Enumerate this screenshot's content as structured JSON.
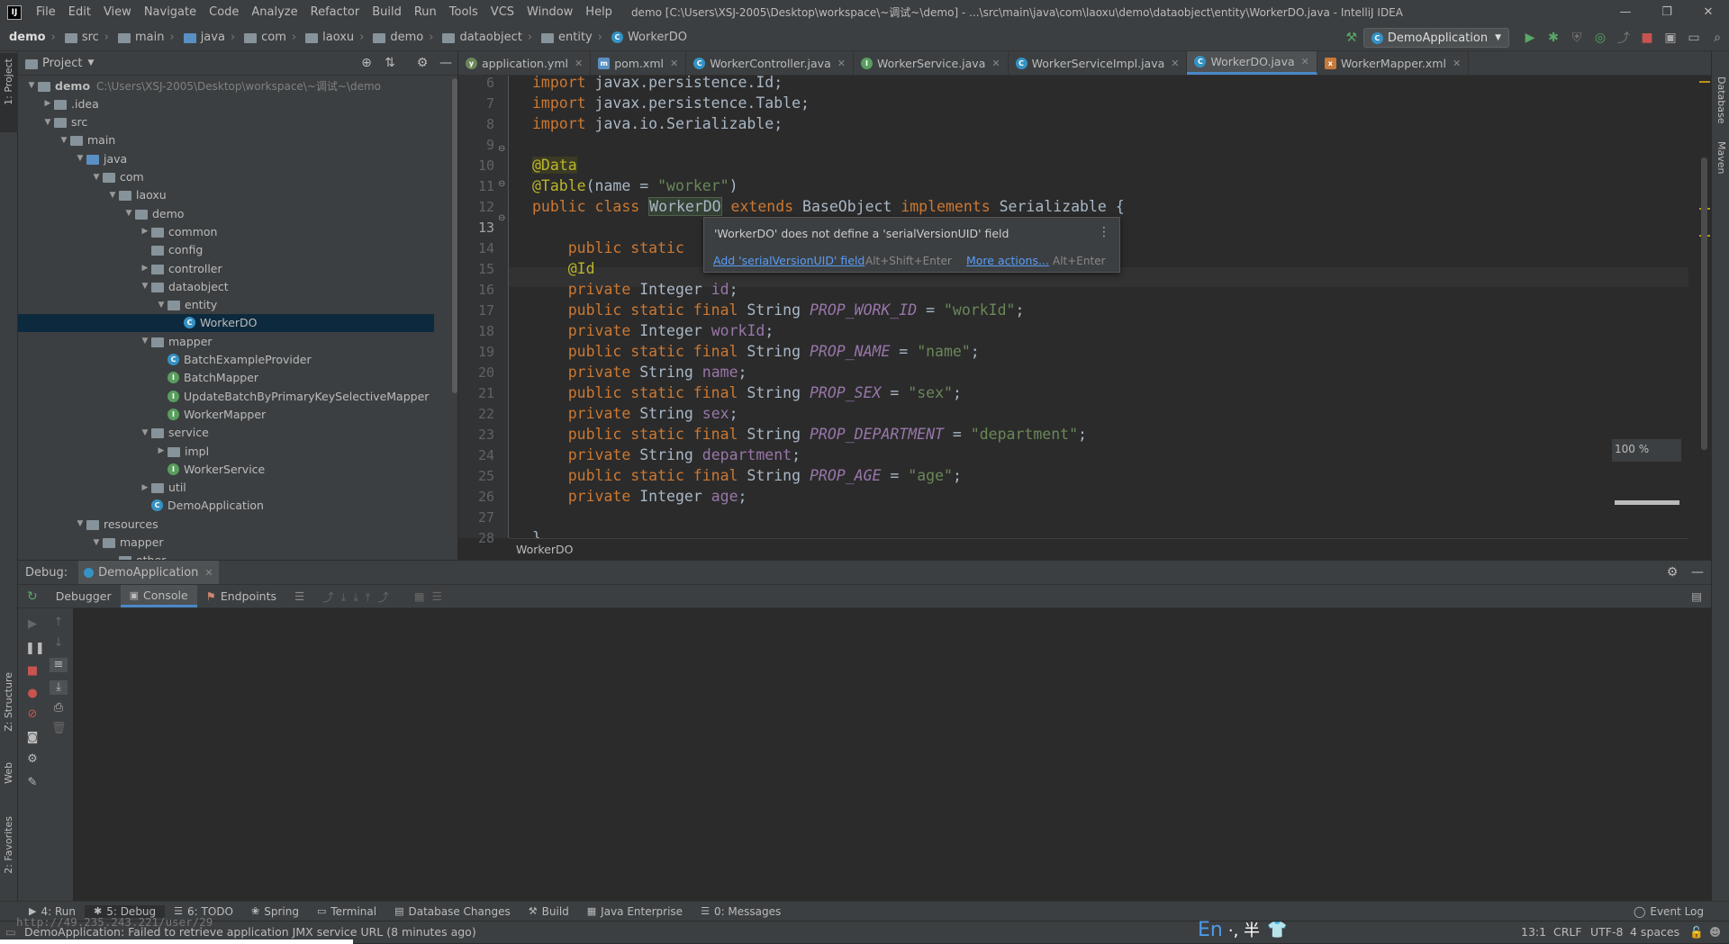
{
  "app": {
    "logo": "IJ",
    "menus": [
      "File",
      "Edit",
      "View",
      "Navigate",
      "Code",
      "Analyze",
      "Refactor",
      "Build",
      "Run",
      "Tools",
      "VCS",
      "Window",
      "Help"
    ],
    "title": "demo [C:\\Users\\XSJ-2005\\Desktop\\workspace\\~调试~\\demo] - ...\\src\\main\\java\\com\\laoxu\\demo\\dataobject\\entity\\WorkerDO.java - IntelliJ IDEA"
  },
  "breadcrumbs": [
    "demo",
    "src",
    "main",
    "java",
    "com",
    "laoxu",
    "demo",
    "dataobject",
    "entity",
    "WorkerDO"
  ],
  "run_config": "DemoApplication",
  "left_tools": {
    "project": "1: Project",
    "structure": "Z: Structure",
    "web": "Web",
    "favorites": "2: Favorites"
  },
  "right_tools": {
    "database": "Database",
    "maven": "Maven"
  },
  "project_panel": {
    "title": "Project",
    "tree": [
      {
        "label": "demo",
        "note": "C:\\Users\\XSJ-2005\\Desktop\\workspace\\~调试~\\demo",
        "depth": 0,
        "arrow": "open",
        "icon": "folder"
      },
      {
        "label": ".idea",
        "depth": 1,
        "arrow": "closed",
        "icon": "folder"
      },
      {
        "label": "src",
        "depth": 1,
        "arrow": "open",
        "icon": "folder"
      },
      {
        "label": "main",
        "depth": 2,
        "arrow": "open",
        "icon": "folder"
      },
      {
        "label": "java",
        "depth": 3,
        "arrow": "open",
        "icon": "folder-blue"
      },
      {
        "label": "com",
        "depth": 4,
        "arrow": "open",
        "icon": "folder"
      },
      {
        "label": "laoxu",
        "depth": 5,
        "arrow": "open",
        "icon": "folder"
      },
      {
        "label": "demo",
        "depth": 6,
        "arrow": "open",
        "icon": "folder"
      },
      {
        "label": "common",
        "depth": 7,
        "arrow": "closed",
        "icon": "folder"
      },
      {
        "label": "config",
        "depth": 7,
        "arrow": "none",
        "icon": "folder"
      },
      {
        "label": "controller",
        "depth": 7,
        "arrow": "closed",
        "icon": "folder"
      },
      {
        "label": "dataobject",
        "depth": 7,
        "arrow": "open",
        "icon": "folder"
      },
      {
        "label": "entity",
        "depth": 8,
        "arrow": "open",
        "icon": "folder"
      },
      {
        "label": "WorkerDO",
        "depth": 9,
        "arrow": "none",
        "icon": "class",
        "selected": true
      },
      {
        "label": "mapper",
        "depth": 7,
        "arrow": "open",
        "icon": "folder"
      },
      {
        "label": "BatchExampleProvider",
        "depth": 8,
        "arrow": "none",
        "icon": "class"
      },
      {
        "label": "BatchMapper",
        "depth": 8,
        "arrow": "none",
        "icon": "interface"
      },
      {
        "label": "UpdateBatchByPrimaryKeySelectiveMapper",
        "depth": 8,
        "arrow": "none",
        "icon": "interface"
      },
      {
        "label": "WorkerMapper",
        "depth": 8,
        "arrow": "none",
        "icon": "interface"
      },
      {
        "label": "service",
        "depth": 7,
        "arrow": "open",
        "icon": "folder"
      },
      {
        "label": "impl",
        "depth": 8,
        "arrow": "closed",
        "icon": "folder"
      },
      {
        "label": "WorkerService",
        "depth": 8,
        "arrow": "none",
        "icon": "interface"
      },
      {
        "label": "util",
        "depth": 7,
        "arrow": "closed",
        "icon": "folder"
      },
      {
        "label": "DemoApplication",
        "depth": 7,
        "arrow": "none",
        "icon": "class"
      },
      {
        "label": "resources",
        "depth": 3,
        "arrow": "open",
        "icon": "folder"
      },
      {
        "label": "mapper",
        "depth": 4,
        "arrow": "open",
        "icon": "folder"
      },
      {
        "label": "other",
        "depth": 5,
        "arrow": "none",
        "icon": "folder"
      }
    ]
  },
  "editor_tabs": [
    {
      "label": "application.yml",
      "icon": "yml"
    },
    {
      "label": "pom.xml",
      "icon": "maven"
    },
    {
      "label": "WorkerController.java",
      "icon": "class"
    },
    {
      "label": "WorkerService.java",
      "icon": "interface"
    },
    {
      "label": "WorkerServiceImpl.java",
      "icon": "class"
    },
    {
      "label": "WorkerDO.java",
      "icon": "class",
      "active": true
    },
    {
      "label": "WorkerMapper.xml",
      "icon": "xml"
    }
  ],
  "code": [
    {
      "n": "6",
      "segs": [
        [
          "kw",
          "import "
        ],
        [
          "",
          "javax.persistence."
        ],
        [
          "",
          "Id;"
        ]
      ]
    },
    {
      "n": "7",
      "segs": [
        [
          "kw",
          "import "
        ],
        [
          "",
          "javax.persistence."
        ],
        [
          "",
          "Table;"
        ]
      ]
    },
    {
      "n": "8",
      "segs": [
        [
          "kw",
          "import "
        ],
        [
          "",
          "java.io.Serializable;"
        ]
      ]
    },
    {
      "n": "9",
      "segs": []
    },
    {
      "n": "10",
      "segs": [
        [
          "ann hl-ann",
          "@Data"
        ]
      ]
    },
    {
      "n": "11",
      "segs": [
        [
          "ann",
          "@Table"
        ],
        [
          "",
          "(name = "
        ],
        [
          "str",
          "\"worker\""
        ],
        [
          "",
          ")"
        ]
      ]
    },
    {
      "n": "12",
      "segs": [
        [
          "kw",
          "public class "
        ],
        [
          "hl-word",
          "WorkerDO"
        ],
        [
          "kw",
          " extends "
        ],
        [
          "",
          "BaseObject "
        ],
        [
          "kw",
          "implements "
        ],
        [
          "",
          "Serializable {"
        ]
      ]
    },
    {
      "n": "13",
      "segs": []
    },
    {
      "n": "14",
      "segs": [
        [
          "kw",
          "    public static "
        ]
      ]
    },
    {
      "n": "15",
      "segs": [
        [
          "ann",
          "    @Id"
        ]
      ]
    },
    {
      "n": "16",
      "segs": [
        [
          "kw",
          "    private "
        ],
        [
          "",
          "Integer "
        ],
        [
          "fld",
          "id"
        ],
        [
          "",
          ";"
        ]
      ]
    },
    {
      "n": "17",
      "segs": [
        [
          "kw",
          "    public static final "
        ],
        [
          "",
          "String "
        ],
        [
          "cst",
          "PROP_WORK_ID"
        ],
        [
          "",
          " = "
        ],
        [
          "str",
          "\"workId\""
        ],
        [
          "",
          ";"
        ]
      ]
    },
    {
      "n": "18",
      "segs": [
        [
          "kw",
          "    private "
        ],
        [
          "",
          "Integer "
        ],
        [
          "fld",
          "workId"
        ],
        [
          "",
          ";"
        ]
      ]
    },
    {
      "n": "19",
      "segs": [
        [
          "kw",
          "    public static final "
        ],
        [
          "",
          "String "
        ],
        [
          "cst",
          "PROP_NAME"
        ],
        [
          "",
          " = "
        ],
        [
          "str",
          "\"name\""
        ],
        [
          "",
          ";"
        ]
      ]
    },
    {
      "n": "20",
      "segs": [
        [
          "kw",
          "    private "
        ],
        [
          "",
          "String "
        ],
        [
          "fld",
          "name"
        ],
        [
          "",
          ";"
        ]
      ]
    },
    {
      "n": "21",
      "segs": [
        [
          "kw",
          "    public static final "
        ],
        [
          "",
          "String "
        ],
        [
          "cst",
          "PROP_SEX"
        ],
        [
          "",
          " = "
        ],
        [
          "str",
          "\"sex\""
        ],
        [
          "",
          ";"
        ]
      ]
    },
    {
      "n": "22",
      "segs": [
        [
          "kw",
          "    private "
        ],
        [
          "",
          "String "
        ],
        [
          "fld",
          "sex"
        ],
        [
          "",
          ";"
        ]
      ]
    },
    {
      "n": "23",
      "segs": [
        [
          "kw",
          "    public static final "
        ],
        [
          "",
          "String "
        ],
        [
          "cst",
          "PROP_DEPARTMENT"
        ],
        [
          "",
          " = "
        ],
        [
          "str",
          "\"department\""
        ],
        [
          "",
          ";"
        ]
      ]
    },
    {
      "n": "24",
      "segs": [
        [
          "kw",
          "    private "
        ],
        [
          "",
          "String "
        ],
        [
          "fld",
          "department"
        ],
        [
          "",
          ";"
        ]
      ]
    },
    {
      "n": "25",
      "segs": [
        [
          "kw",
          "    public static final "
        ],
        [
          "",
          "String "
        ],
        [
          "cst",
          "PROP_AGE"
        ],
        [
          "",
          " = "
        ],
        [
          "str",
          "\"age\""
        ],
        [
          "",
          ";"
        ]
      ]
    },
    {
      "n": "26",
      "segs": [
        [
          "kw",
          "    private "
        ],
        [
          "",
          "Integer "
        ],
        [
          "fld",
          "age"
        ],
        [
          "",
          ";"
        ]
      ]
    },
    {
      "n": "27",
      "segs": []
    },
    {
      "n": "28",
      "segs": [
        [
          "",
          "}"
        ]
      ]
    }
  ],
  "editor_breadcrumb": "WorkerDO",
  "tooltip": {
    "message": "'WorkerDO' does not define a 'serialVersionUID' field",
    "action1": "Add 'serialVersionUID' field",
    "key1": "Alt+Shift+Enter",
    "action2": "More actions...",
    "key2": "Alt+Enter"
  },
  "zoom": "100 %",
  "debug": {
    "title": "Debug:",
    "session": "DemoApplication",
    "tabs": [
      "Debugger",
      "Console",
      "Endpoints"
    ]
  },
  "bottom_tools": [
    {
      "label": "4: Run",
      "icon": "▶"
    },
    {
      "label": "5: Debug",
      "icon": "✱",
      "active": true
    },
    {
      "label": "6: TODO",
      "icon": "☰"
    },
    {
      "label": "Spring",
      "icon": "❀"
    },
    {
      "label": "Terminal",
      "icon": "▭"
    },
    {
      "label": "Database Changes",
      "icon": "▤"
    },
    {
      "label": "Build",
      "icon": "⚒"
    },
    {
      "label": "Java Enterprise",
      "icon": "▦"
    },
    {
      "label": "0: Messages",
      "icon": "☰"
    }
  ],
  "event_log": "Event Log",
  "status": {
    "message": "DemoApplication: Failed to retrieve application JMX service URL (8 minutes ago)",
    "url_overlay": "http://49.235.243.221/user/29",
    "position": "13:1",
    "line_sep": "CRLF",
    "encoding": "UTF-8",
    "indent": "4 spaces"
  },
  "ime": {
    "lang": "En",
    "chars": "·, 半"
  }
}
